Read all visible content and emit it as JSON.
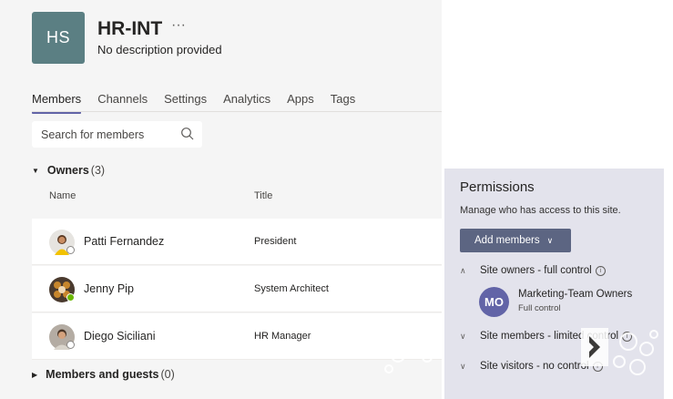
{
  "team": {
    "initials": "HS",
    "name": "HR-INT",
    "more_label": "···",
    "description": "No description provided"
  },
  "tabs": [
    {
      "label": "Members",
      "active": true
    },
    {
      "label": "Channels"
    },
    {
      "label": "Settings"
    },
    {
      "label": "Analytics"
    },
    {
      "label": "Apps"
    },
    {
      "label": "Tags"
    }
  ],
  "search": {
    "placeholder": "Search for members",
    "icon": "search-icon"
  },
  "owners_section": {
    "label": "Owners",
    "count": "(3)"
  },
  "columns": {
    "name": "Name",
    "title": "Title"
  },
  "members": [
    {
      "name": "Patti Fernandez",
      "title": "President",
      "presence": "offline"
    },
    {
      "name": "Jenny Pip",
      "title": "System Architect",
      "presence": "available"
    },
    {
      "name": "Diego Siciliani",
      "title": "HR Manager",
      "presence": "offline"
    }
  ],
  "guests_section": {
    "label": "Members and guests",
    "count": "(0)"
  },
  "permissions": {
    "title": "Permissions",
    "subtitle": "Manage who has access to this site.",
    "add_button": "Add members",
    "groups": [
      {
        "label": "Site owners - full control",
        "expanded": true
      },
      {
        "label": "Site members - limited control",
        "expanded": false
      },
      {
        "label": "Site visitors - no control",
        "expanded": false
      }
    ],
    "owner_entry": {
      "initials": "MO",
      "name": "Marketing-Team Owners",
      "role": "Full control"
    }
  },
  "colors": {
    "accent": "#6264a7",
    "add_button": "#5c6582",
    "team_avatar": "#5b7f83",
    "available": "#6bb700"
  }
}
